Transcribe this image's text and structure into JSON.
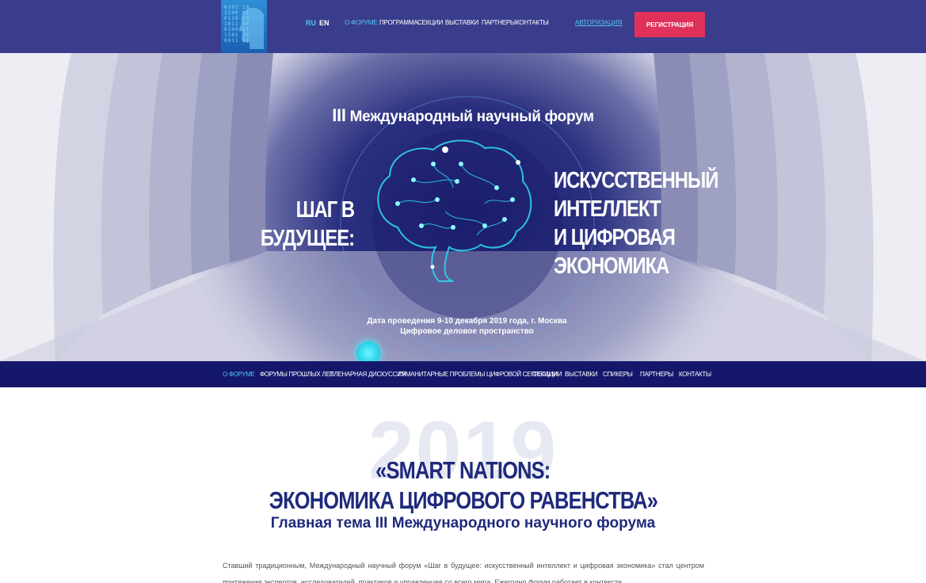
{
  "header": {
    "lang_ru": "RU",
    "lang_en": "EN",
    "nav": [
      "О ФОРУМЕ",
      "ПРОГРАММА",
      "СЕКЦИИ",
      "ВЫСТАВКИ",
      "ПАРТНЕРЫ",
      "КОНТАКТЫ"
    ],
    "auth_link": "АВТОРИЗАЦИЯ",
    "register_button": "РЕГИСТРАЦИЯ"
  },
  "hero": {
    "roman": "III",
    "title": "Международный научный форум",
    "left_title_line1": "ШАГ В",
    "left_title_line2": "БУДУЩЕЕ:",
    "right_title_line1": "ИСКУССТВЕННЫЙ",
    "right_title_line2": "ИНТЕЛЛЕКТ",
    "right_title_line3": "И ЦИФРОВАЯ",
    "right_title_line4": "ЭКОНОМИКА",
    "date": "Дата проведения 9-10 декабря 2019 года, г. Москва",
    "venue": "Цифровое деловое пространство"
  },
  "subnav": [
    "О ФОРУМЕ",
    "ФОРУМЫ ПРОШЛЫХ ЛЕТ",
    "ПЛЕНАРНАЯ ДИСКУССИЯ",
    "ГУМАНИТАРНЫЕ ПРОБЛЕМЫ ЦИФРОВОЙ СЕГРЕГАЦИИ",
    "СЕКЦИИ",
    "ВЫСТАВКИ",
    "СПИКЕРЫ",
    "ПАРТНЕРЫ",
    "КОНТАКТЫ"
  ],
  "main": {
    "year": "2019",
    "theme_line1": "«SMART NATIONS:",
    "theme_line2": "ЭКОНОМИКА ЦИФРОВОГО РАВЕНСТВА»",
    "subtitle": "Главная тема III Международного научного форума",
    "paragraph": "Ставший традиционным, Международный научный форум «Шаг в будущее: искусственный интеллект и цифровая экономика» стал центром притяжения экспертов, исследователей, практиков и управленцев со всего мира. Ежегодно Форум работает в контексте"
  },
  "colors": {
    "header_bg": "#3a3d8c",
    "accent": "#4fc3f7",
    "register_bg": "#e0315a",
    "subnav_bg": "#15186a",
    "heading": "#1f2a7c"
  }
}
